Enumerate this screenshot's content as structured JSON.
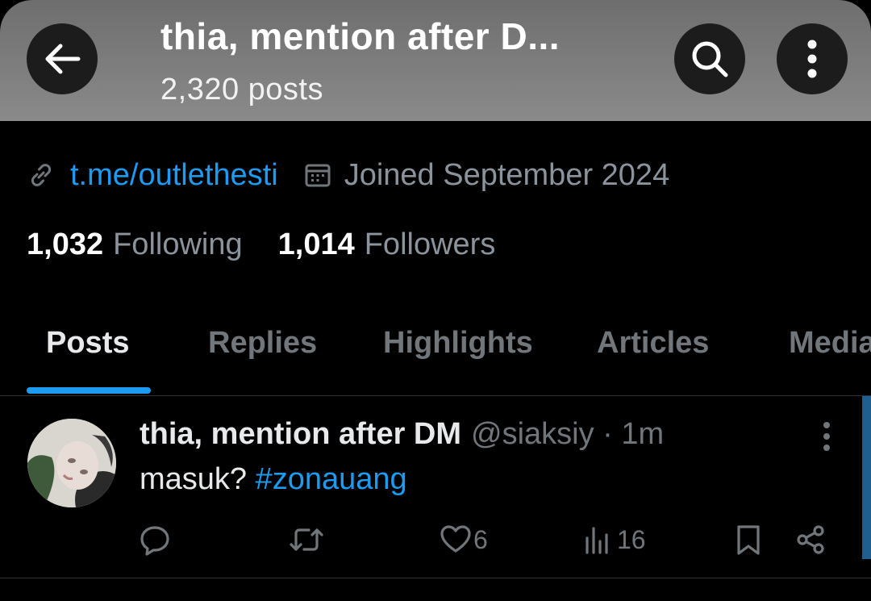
{
  "header": {
    "title": "thia, mention after D...",
    "post_count": "2,320 posts",
    "icons": {
      "back": "arrow-left-icon",
      "search": "search-icon",
      "more": "more-vertical-icon"
    }
  },
  "profile": {
    "link": "t.me/outlethesti",
    "joined": "Joined September 2024",
    "following_count": "1,032",
    "following_label": "Following",
    "followers_count": "1,014",
    "followers_label": "Followers"
  },
  "tabs": [
    {
      "label": "Posts",
      "active": true
    },
    {
      "label": "Replies",
      "active": false
    },
    {
      "label": "Highlights",
      "active": false
    },
    {
      "label": "Articles",
      "active": false
    },
    {
      "label": "Media",
      "active": false
    }
  ],
  "post": {
    "author_name": "thia, mention after DM",
    "handle_time": "@siaksiy · 1m",
    "text": "masuk? ",
    "hashtag": "#zonauang",
    "likes": "6",
    "views": "16"
  },
  "colors": {
    "accent": "#1d9bf0",
    "muted": "#71767b",
    "background": "#000000"
  }
}
